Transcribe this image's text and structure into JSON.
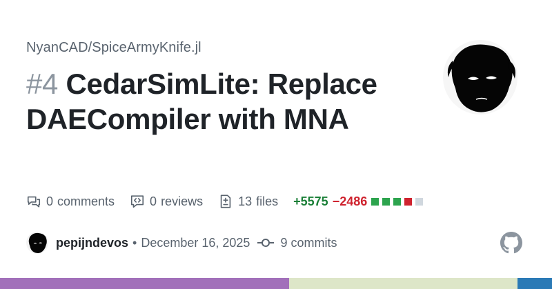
{
  "repo": "NyanCAD/SpiceArmyKnife.jl",
  "pr": {
    "number": "#4",
    "title": "CedarSimLite: Replace DAECompiler with MNA"
  },
  "stats": {
    "comments_count": "0",
    "comments_label": "comments",
    "reviews_count": "0",
    "reviews_label": "reviews",
    "files_count": "13",
    "files_label": "files",
    "additions": "+5575",
    "deletions": "−2486",
    "diff_blocks": [
      "added",
      "added",
      "added",
      "deleted",
      "neutral"
    ]
  },
  "footer": {
    "author": "pepijndevos",
    "separator": "•",
    "date": "December 16, 2025",
    "commits_count": "9",
    "commits_label": "commits"
  },
  "colors": {
    "added": "#2da44e",
    "deleted": "#cf222e",
    "neutral": "#d0d7de",
    "lang_bar": [
      "#a270ba",
      "#dde6c8",
      "#2b7ab6"
    ]
  },
  "language_bar": [
    0.524,
    0.414,
    0.062
  ],
  "icons": [
    "comment-icon",
    "code-review-icon",
    "file-diff-icon",
    "git-commit-icon",
    "github-mark-icon"
  ]
}
